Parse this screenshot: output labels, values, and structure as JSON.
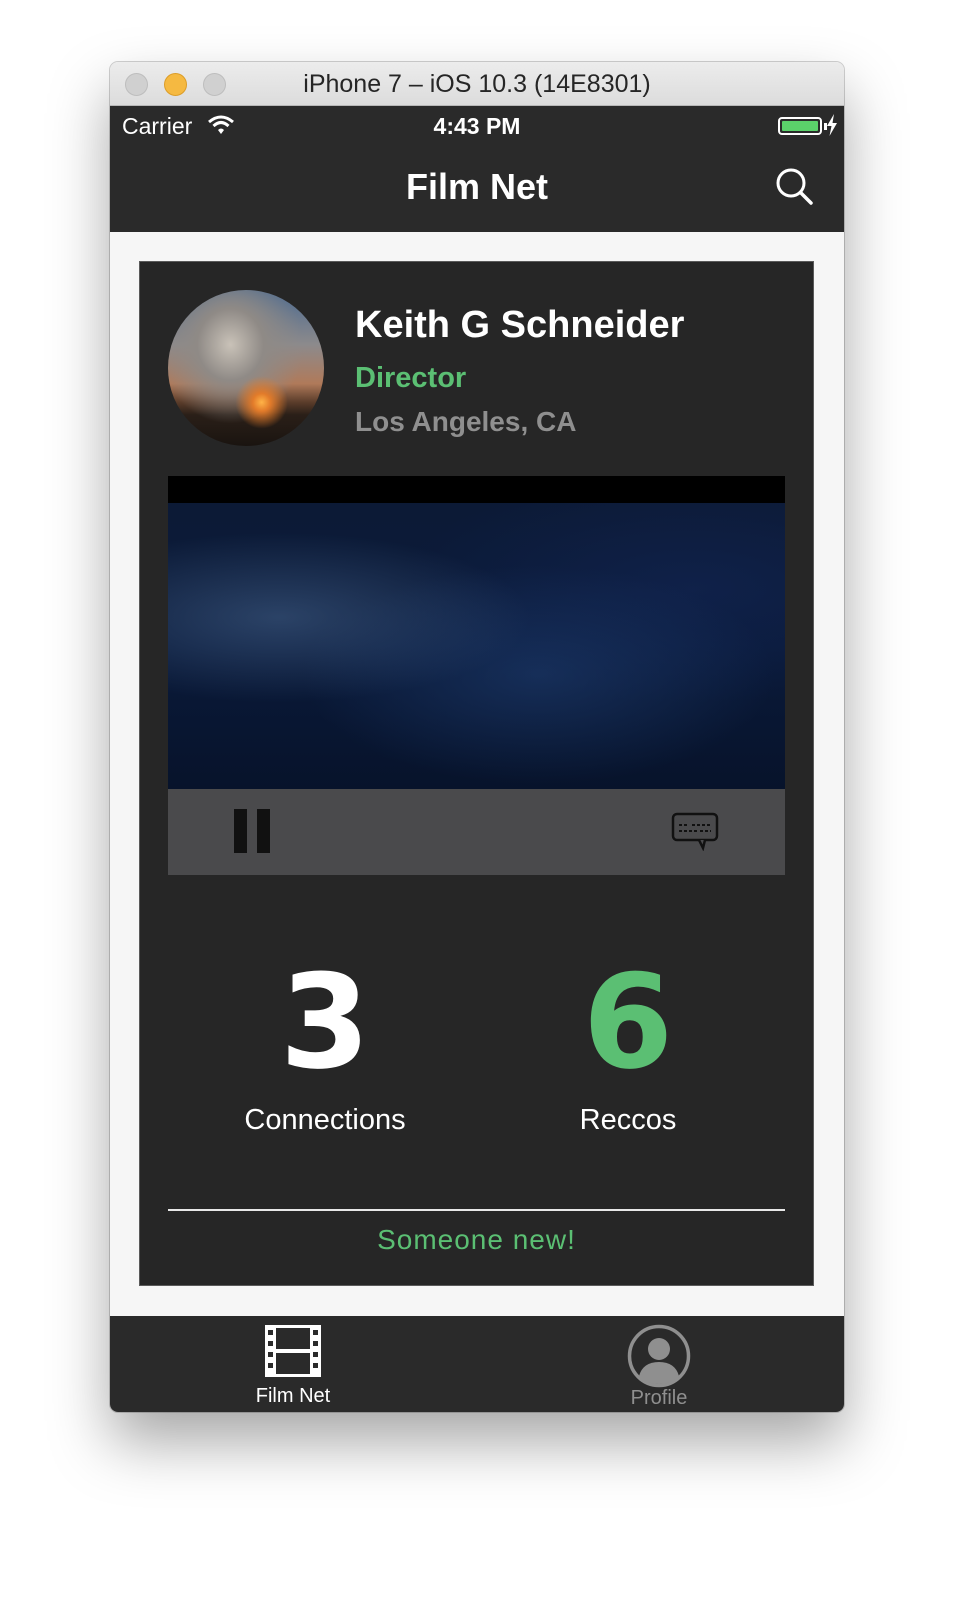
{
  "window": {
    "title": "iPhone 7 – iOS 10.3 (14E8301)"
  },
  "status_bar": {
    "carrier": "Carrier",
    "time": "4:43 PM"
  },
  "nav": {
    "title": "Film Net"
  },
  "profile": {
    "name": "Keith G Schneider",
    "role": "Director",
    "location": "Los Angeles, CA"
  },
  "stats": {
    "connections": {
      "value": "3",
      "label": "Connections"
    },
    "reccos": {
      "value": "6",
      "label": "Reccos"
    }
  },
  "footer_link": "Someone new!",
  "tabs": [
    {
      "label": "Film Net",
      "icon": "film-icon"
    },
    {
      "label": "Profile",
      "icon": "profile-icon"
    }
  ],
  "colors": {
    "accent_green": "#5bbf73",
    "bar_dark": "#2a2a2a",
    "card_bg": "#262626"
  }
}
